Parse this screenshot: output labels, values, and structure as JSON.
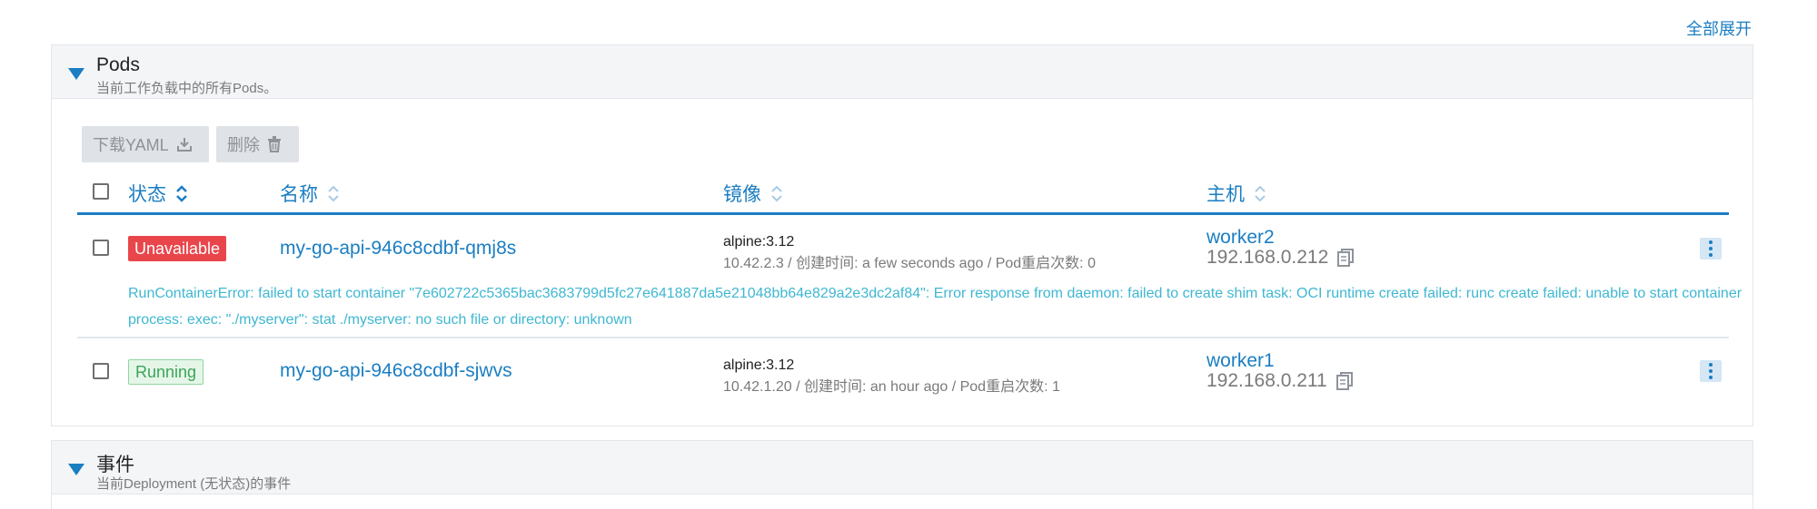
{
  "toolbar": {
    "expand_all": "全部展开"
  },
  "pods_panel": {
    "title": "Pods",
    "subtitle": "当前工作负载中的所有Pods。",
    "buttons": {
      "download_yaml": "下载YAML",
      "delete": "删除"
    },
    "columns": {
      "state": "状态",
      "name": "名称",
      "image": "镜像",
      "host": "主机"
    },
    "rows": [
      {
        "state": "Unavailable",
        "name": "my-go-api-946c8cdbf-qmj8s",
        "image": "alpine:3.12",
        "meta": "10.42.2.3 / 创建时间: a few seconds ago / Pod重启次数: 0",
        "host": "worker2",
        "host_ip": "192.168.0.212",
        "error": "RunContainerError: failed to start container \"7e602722c5365bac3683799d5fc27e641887da5e21048bb64e829a2e3dc2af84\": Error response from daemon: failed to create shim task: OCI runtime create failed: runc create failed: unable to start container process: exec: \"./myserver\": stat ./myserver: no such file or directory: unknown"
      },
      {
        "state": "Running",
        "name": "my-go-api-946c8cdbf-sjwvs",
        "image": "alpine:3.12",
        "meta": "10.42.1.20 / 创建时间: an hour ago / Pod重启次数: 1",
        "host": "worker1",
        "host_ip": "192.168.0.211",
        "error": ""
      }
    ]
  },
  "events_panel": {
    "title": "事件",
    "subtitle": "当前Deployment (无状态)的事件"
  },
  "colors": {
    "accent": "#1b7ec2",
    "error_badge": "#e9464b",
    "running_badge_text": "#3aa55a",
    "error_text": "#3fb7d1"
  }
}
